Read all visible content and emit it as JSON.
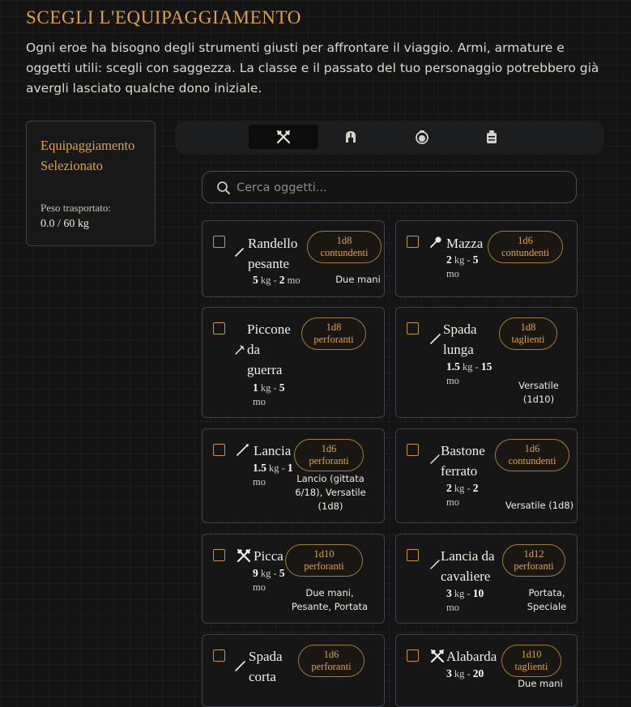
{
  "header": {
    "title": "SCEGLI L'EQUIPAGGIAMENTO",
    "intro": "Ogni eroe ha bisogno degli strumenti giusti per affrontare il viaggio. Armi, armature e oggetti utili: scegli con saggezza. La classe e il passato del tuo personaggio potrebbero già avergli lasciato qualche dono iniziale."
  },
  "selected": {
    "title": "Equipaggiamento Selezionato",
    "weight_label": "Peso trasportato:",
    "weight_value": "0.0 / 60 kg"
  },
  "tabs": [
    {
      "icon": "crossed-weapons-icon",
      "active": true
    },
    {
      "icon": "helmet-icon",
      "active": false
    },
    {
      "icon": "potion-icon",
      "active": false
    },
    {
      "icon": "backpack-icon",
      "active": false
    }
  ],
  "search": {
    "placeholder": "Cerca oggetti..."
  },
  "items": [
    {
      "name": "Randello\npesante",
      "icon": "club-icon",
      "weight": "5",
      "weight_unit": "kg",
      "cost": "2",
      "cost_unit": "mo",
      "damage_die": "1d8",
      "damage_type": "contundenti",
      "properties": "Due mani"
    },
    {
      "name": "Mazza",
      "icon": "mace-icon",
      "weight": "2",
      "weight_unit": "kg",
      "cost": "5",
      "cost_unit": "mo",
      "damage_die": "1d6",
      "damage_type": "contundenti",
      "properties": ""
    },
    {
      "name": "Piccone\nda\nguerra",
      "icon": "pick-icon",
      "weight": "1",
      "weight_unit": "kg",
      "cost": "5",
      "cost_unit": "mo",
      "damage_die": "1d8",
      "damage_type": "perforanti",
      "properties": ""
    },
    {
      "name": "Spada\nlunga",
      "icon": "sword-icon",
      "weight": "1.5",
      "weight_unit": "kg",
      "cost": "15",
      "cost_unit": "mo",
      "damage_die": "1d8",
      "damage_type": "taglienti",
      "properties": "Versatile\n(1d10)"
    },
    {
      "name": "Lancia",
      "icon": "spear-icon",
      "weight": "1.5",
      "weight_unit": "kg",
      "cost": "1",
      "cost_unit": "mo",
      "damage_die": "1d6",
      "damage_type": "perforanti",
      "properties": "Lancio (gittata\n6/18), Versatile\n(1d8)"
    },
    {
      "name": "Bastone\nferrato",
      "icon": "staff-icon",
      "weight": "2",
      "weight_unit": "kg",
      "cost": "2",
      "cost_unit": "mo",
      "damage_die": "1d6",
      "damage_type": "contundenti",
      "properties": "Versatile (1d8)"
    },
    {
      "name": "Picca",
      "icon": "crossed-weapons-icon",
      "weight": "9",
      "weight_unit": "kg",
      "cost": "5",
      "cost_unit": "mo",
      "damage_die": "1d10",
      "damage_type": "perforanti",
      "properties": "Due mani,\nPesante, Portata"
    },
    {
      "name": "Lancia da\ncavaliere",
      "icon": "lance-icon",
      "weight": "3",
      "weight_unit": "kg",
      "cost": "10",
      "cost_unit": "mo",
      "damage_die": "1d12",
      "damage_type": "perforanti",
      "properties": "Portata,\nSpeciale"
    },
    {
      "name": "Spada\ncorta",
      "icon": "sword-icon",
      "weight": "",
      "weight_unit": "",
      "cost": "",
      "cost_unit": "",
      "damage_die": "1d6",
      "damage_type": "perforanti",
      "properties": ""
    },
    {
      "name": "Alabarda",
      "icon": "crossed-weapons-icon",
      "weight": "3",
      "weight_unit": "kg",
      "cost": "20",
      "cost_unit": "",
      "damage_die": "1d10",
      "damage_type": "taglienti",
      "properties": "Due mani"
    }
  ]
}
